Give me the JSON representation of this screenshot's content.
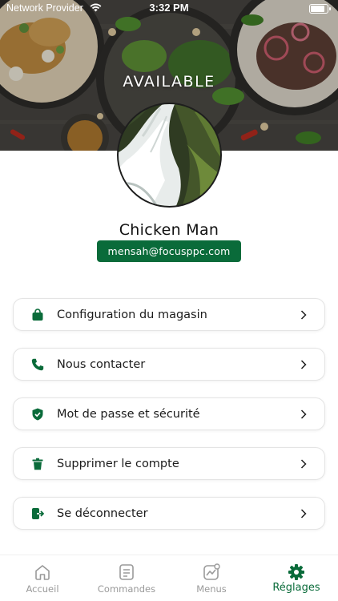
{
  "status_bar": {
    "carrier": "Network Provider",
    "time": "3:32 PM",
    "battery_level": 0.9
  },
  "header": {
    "availability": "AVAILABLE"
  },
  "profile": {
    "name": "Chicken Man",
    "email": "mensah@focusppc.com"
  },
  "menu": {
    "items": [
      {
        "label": "Configuration du magasin",
        "icon": "shopping-bag-icon"
      },
      {
        "label": "Nous contacter",
        "icon": "phone-icon"
      },
      {
        "label": "Mot de passe et sécurité",
        "icon": "shield-check-icon"
      },
      {
        "label": "Supprimer le compte",
        "icon": "trash-icon"
      },
      {
        "label": "Se déconnecter",
        "icon": "logout-icon"
      }
    ]
  },
  "tabs": [
    {
      "label": "Accueil",
      "icon": "home-icon",
      "active": false
    },
    {
      "label": "Commandes",
      "icon": "orders-icon",
      "active": false
    },
    {
      "label": "Menus",
      "icon": "chart-icon",
      "active": false
    },
    {
      "label": "Réglages",
      "icon": "gear-icon",
      "active": true
    }
  ],
  "colors": {
    "accent": "#0a6b3a",
    "inactive": "#9a9a9a"
  }
}
